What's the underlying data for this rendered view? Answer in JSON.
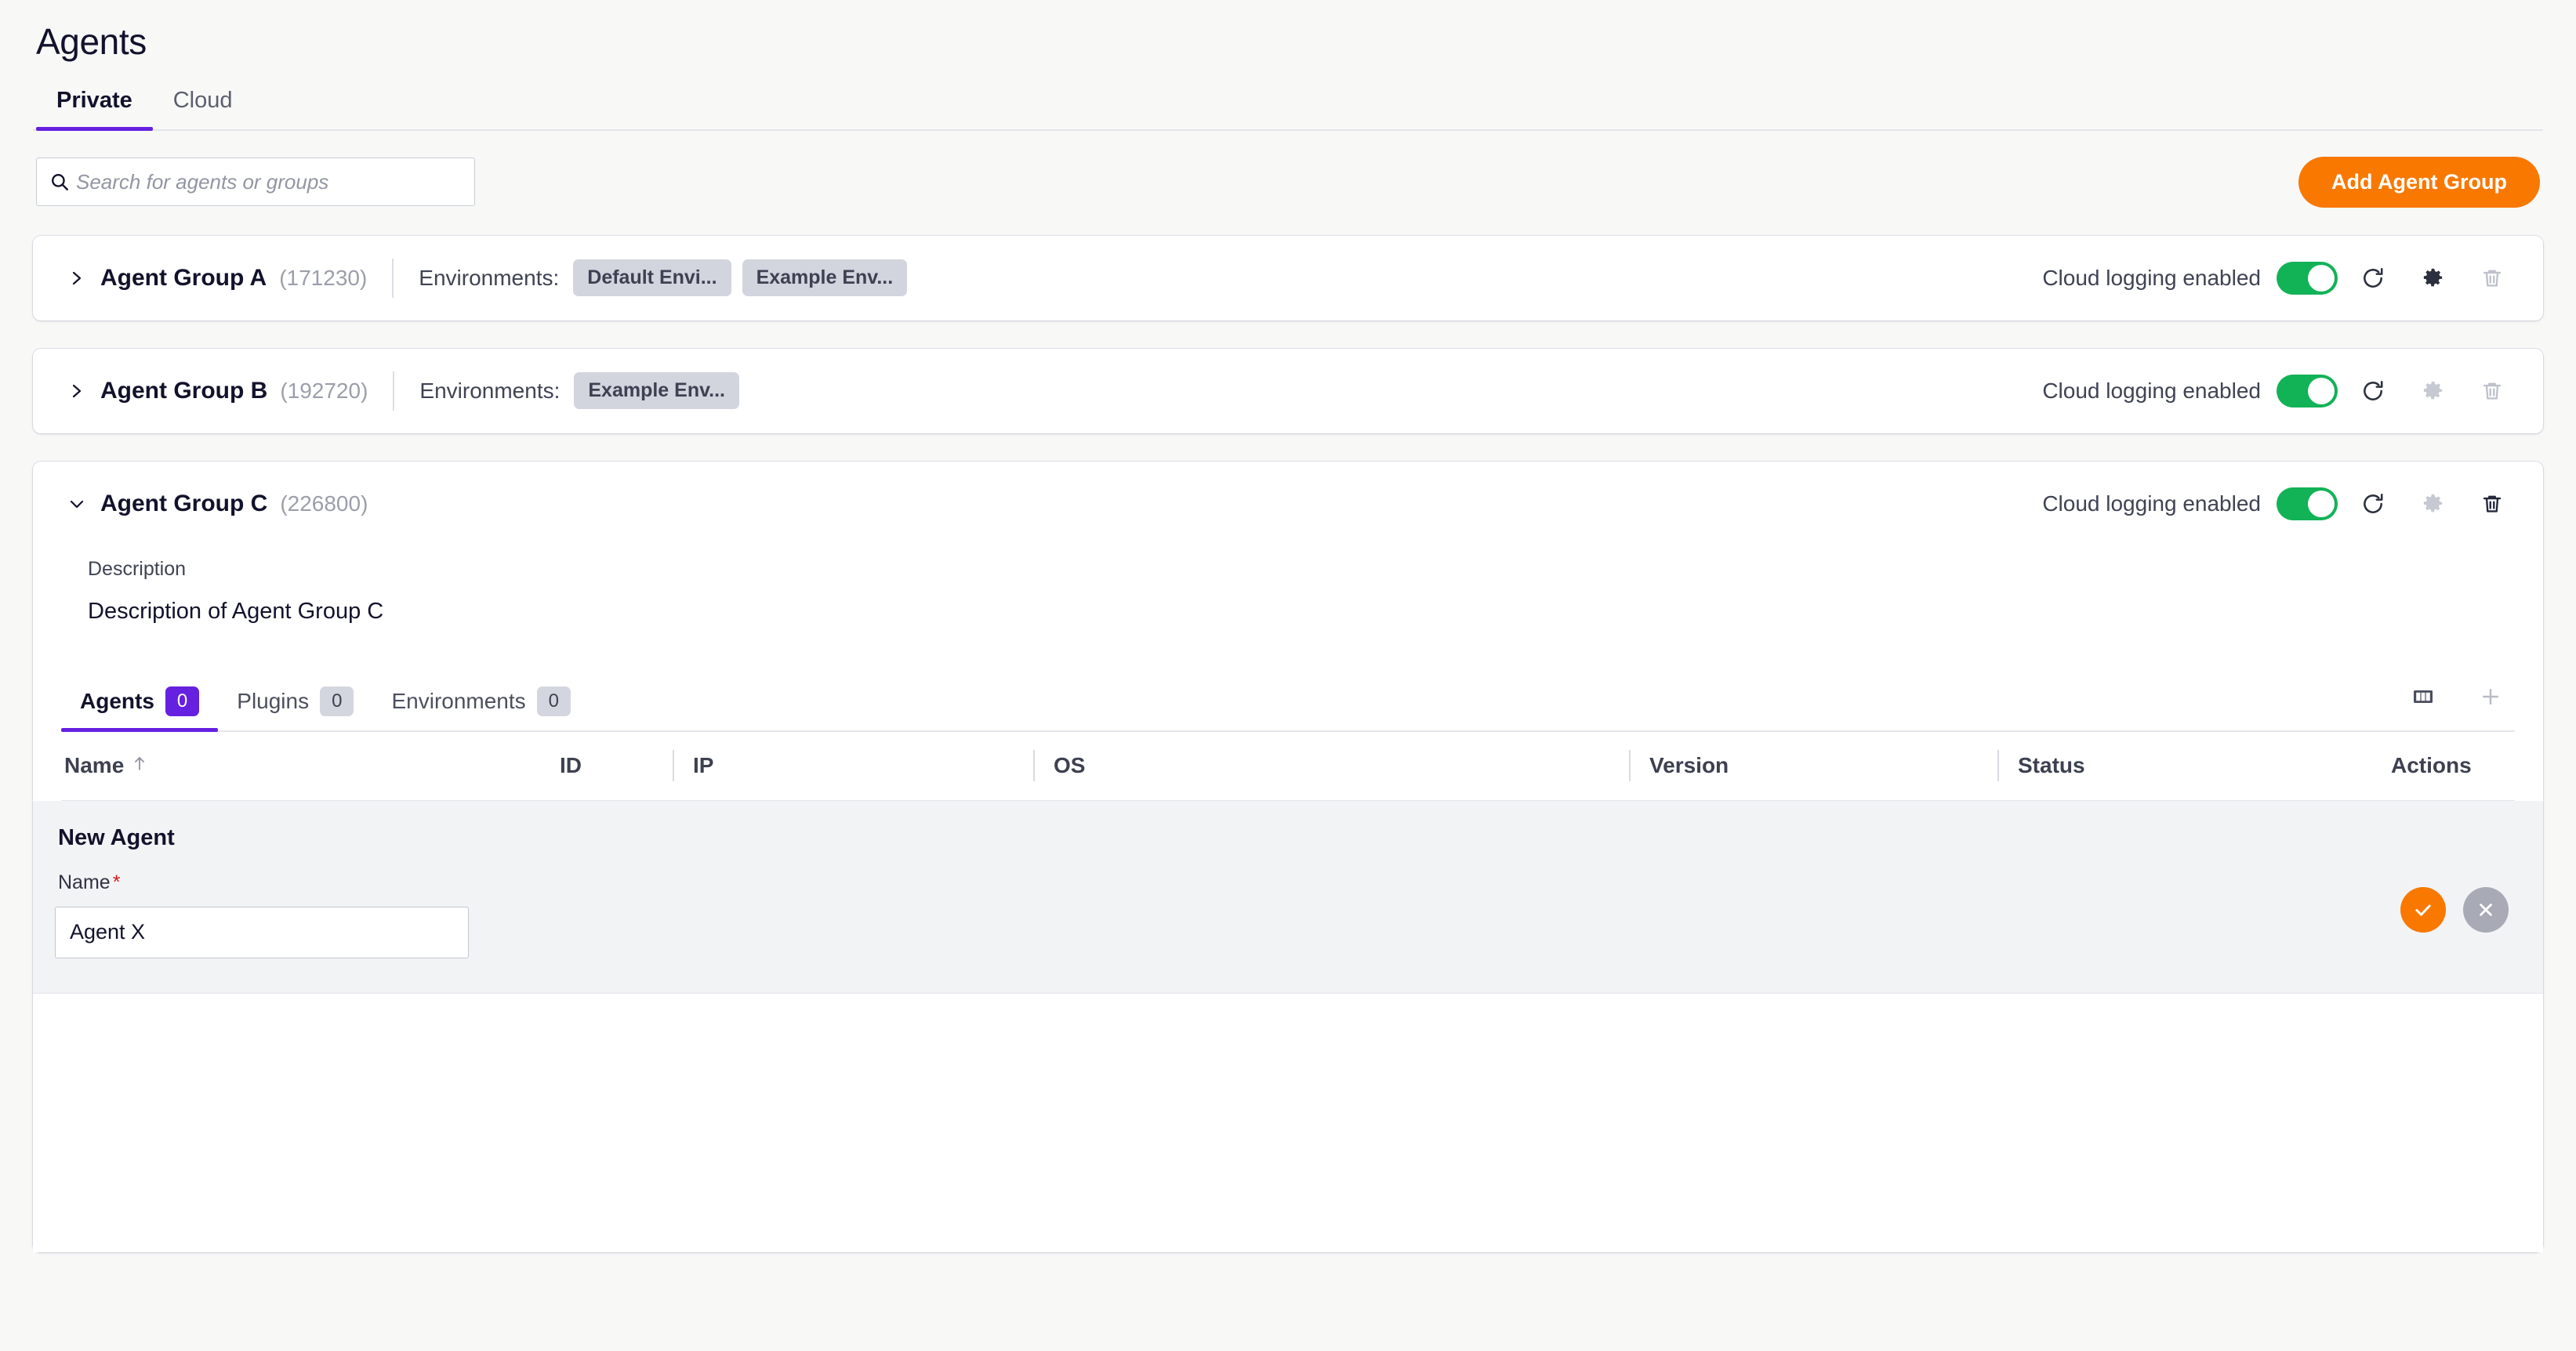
{
  "page": {
    "title": "Agents"
  },
  "top_tabs": [
    {
      "label": "Private",
      "active": true
    },
    {
      "label": "Cloud",
      "active": false
    }
  ],
  "toolbar": {
    "search_placeholder": "Search for agents or groups",
    "search_value": "",
    "search_icon": "search-icon",
    "add_group_label": "Add Agent Group"
  },
  "colors": {
    "accent_purple": "#6620e0",
    "accent_orange": "#f97800",
    "toggle_green": "#12b257",
    "required_red": "#d41b1b",
    "page_bg": "#f8f8f7",
    "chip_bg": "#d2d4de"
  },
  "groups": [
    {
      "name": "Agent Group A",
      "id": "(171230)",
      "expanded": false,
      "chevron_icon": "chevron-right-icon",
      "environments_label": "Environments:",
      "environment_chips": [
        "Default Envi...",
        "Example Env..."
      ],
      "logging_label": "Cloud logging enabled",
      "logging_on": true,
      "actions": [
        {
          "icon": "restore-icon",
          "disabled": false
        },
        {
          "icon": "gear-icon",
          "disabled": false
        },
        {
          "icon": "trash-icon",
          "disabled": true
        }
      ]
    },
    {
      "name": "Agent Group B",
      "id": "(192720)",
      "expanded": false,
      "chevron_icon": "chevron-right-icon",
      "environments_label": "Environments:",
      "environment_chips": [
        "Example Env..."
      ],
      "logging_label": "Cloud logging enabled",
      "logging_on": true,
      "actions": [
        {
          "icon": "restore-icon",
          "disabled": false
        },
        {
          "icon": "gear-icon",
          "disabled": true
        },
        {
          "icon": "trash-icon",
          "disabled": true
        }
      ]
    },
    {
      "name": "Agent Group C",
      "id": "(226800)",
      "expanded": true,
      "chevron_icon": "chevron-down-icon",
      "environments_label": "",
      "environment_chips": [],
      "logging_label": "Cloud logging enabled",
      "logging_on": true,
      "actions": [
        {
          "icon": "restore-icon",
          "disabled": false
        },
        {
          "icon": "gear-icon",
          "disabled": true
        },
        {
          "icon": "trash-icon",
          "disabled": false
        }
      ],
      "details": {
        "description_label": "Description",
        "description_value": "Description of Agent Group C"
      },
      "inner_tabs": [
        {
          "label": "Agents",
          "count": "0",
          "active": true
        },
        {
          "label": "Plugins",
          "count": "0",
          "active": false
        },
        {
          "label": "Environments",
          "count": "0",
          "active": false
        }
      ],
      "tab_actions": [
        {
          "icon": "columns-icon",
          "disabled": false
        },
        {
          "icon": "plus-icon",
          "disabled": true
        }
      ],
      "table": {
        "columns": [
          {
            "label": "Name",
            "sort": "asc"
          },
          {
            "label": "ID",
            "sort": ""
          },
          {
            "label": "IP",
            "sort": ""
          },
          {
            "label": "OS",
            "sort": ""
          },
          {
            "label": "Version",
            "sort": ""
          },
          {
            "label": "Status",
            "sort": ""
          },
          {
            "label": "Actions",
            "sort": ""
          }
        ],
        "rows": [],
        "new_row": {
          "title": "New Agent",
          "name_label": "Name",
          "required_mark": "*",
          "name_value": "Agent X",
          "name_placeholder": "",
          "confirm_icon": "check-icon",
          "cancel_icon": "close-icon"
        }
      }
    }
  ]
}
